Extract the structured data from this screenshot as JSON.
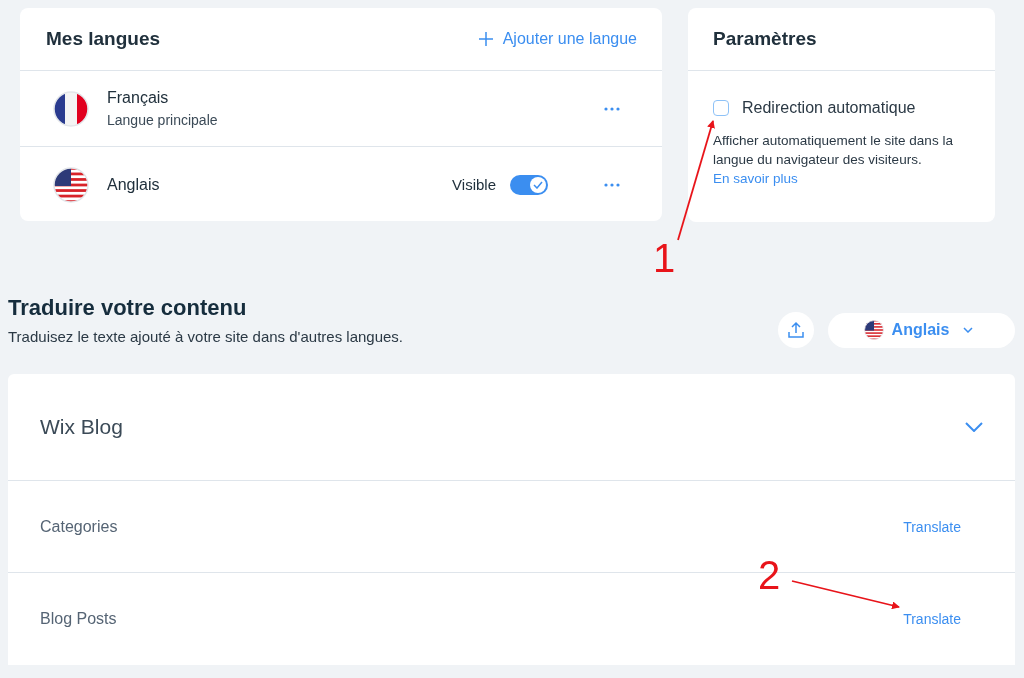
{
  "languages": {
    "title": "Mes langues",
    "add_action": "Ajouter une langue",
    "items": [
      {
        "name": "Français",
        "subtitle": "Langue principale",
        "kind": "fr"
      },
      {
        "name": "Anglais",
        "kind": "us",
        "visibility_label": "Visible",
        "visible": true
      }
    ]
  },
  "settings": {
    "title": "Paramètres",
    "option": {
      "label": "Redirection automatique",
      "checked": false
    },
    "description": "Afficher automatiquement le site dans la langue du navigateur des visiteurs.",
    "link": "En savoir plus"
  },
  "translate": {
    "title": "Traduire votre contenu",
    "subtitle": "Traduisez le texte ajouté à votre site dans d'autres langues.",
    "language_select": {
      "label": "Anglais",
      "kind": "us"
    },
    "app": {
      "title": "Wix Blog",
      "expanded": true,
      "items": [
        {
          "label": "Categories",
          "action": "Translate"
        },
        {
          "label": "Blog Posts",
          "action": "Translate"
        }
      ]
    }
  },
  "annotations": [
    {
      "label": "1"
    },
    {
      "label": "2"
    }
  ]
}
